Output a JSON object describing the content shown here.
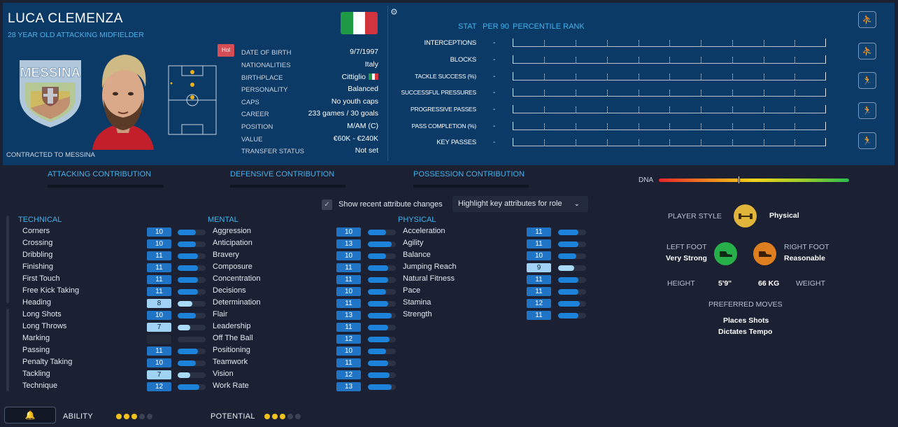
{
  "player": {
    "name": "LUCA CLEMENZA",
    "subtitle": "28 YEAR OLD  ATTACKING MIDFIELDER",
    "contract": "CONTRACTED TO MESSINA",
    "club_badge_text": "MESSINA",
    "hol_tag": "Hol",
    "flag_colors": [
      "#1f9a45",
      "#ffffff",
      "#d2343d"
    ]
  },
  "info": [
    {
      "label": "DATE OF BIRTH",
      "value": "9/7/1997"
    },
    {
      "label": "NATIONALITIES",
      "value": "Italy"
    },
    {
      "label": "BIRTHPLACE",
      "value": "Cittiglio"
    },
    {
      "label": "PERSONALITY",
      "value": "Balanced"
    },
    {
      "label": "CAPS",
      "value": "No youth caps"
    },
    {
      "label": "CAREER",
      "value": "233 games /  30  goals"
    },
    {
      "label": "POSITION",
      "value": "M/AM (C)"
    },
    {
      "label": "VALUE",
      "value": "€60K - €240K"
    },
    {
      "label": "TRANSFER STATUS",
      "value": "Not set"
    }
  ],
  "stats": {
    "headers": {
      "stat": "STAT",
      "per90": "PER 90",
      "rank": "PERCENTILE RANK"
    },
    "rows": [
      {
        "label": "INTERCEPTIONS",
        "per90": "-"
      },
      {
        "label": "BLOCKS",
        "per90": "-"
      },
      {
        "label": "TACKLE SUCCESS (%)",
        "per90": "-"
      },
      {
        "label": "SUCCESSFUL PRESSURES",
        "per90": "-"
      },
      {
        "label": "PROGRESSIVE PASSES",
        "per90": "-"
      },
      {
        "label": "PASS COMPLETION (%)",
        "per90": "-"
      },
      {
        "label": "KEY PASSES",
        "per90": "-"
      }
    ]
  },
  "contribution": {
    "attacking": "ATTACKING CONTRIBUTION",
    "defensive": "DEFENSIVE CONTRIBUTION",
    "possession": "POSSESSION CONTRIBUTION"
  },
  "dna": {
    "label": "DNA",
    "level": 0.42
  },
  "toolbar": {
    "show_changes": "Show recent attribute changes",
    "highlight": "Highlight key attributes for role"
  },
  "attributes": {
    "technical": {
      "title": "TECHNICAL",
      "items": [
        {
          "name": "Corners",
          "value": "10"
        },
        {
          "name": "Crossing",
          "value": "10"
        },
        {
          "name": "Dribbling",
          "value": "11"
        },
        {
          "name": "Finishing",
          "value": "11"
        },
        {
          "name": "First Touch",
          "value": "11"
        },
        {
          "name": "Free Kick Taking",
          "value": "11"
        },
        {
          "name": "Heading",
          "value": "8"
        },
        {
          "name": "Long Shots",
          "value": "10"
        },
        {
          "name": "Long Throws",
          "value": "7"
        },
        {
          "name": "Marking",
          "value": ""
        },
        {
          "name": "Passing",
          "value": "11"
        },
        {
          "name": "Penalty Taking",
          "value": "10"
        },
        {
          "name": "Tackling",
          "value": "7"
        },
        {
          "name": "Technique",
          "value": "12"
        }
      ]
    },
    "mental": {
      "title": "MENTAL",
      "items": [
        {
          "name": "Aggression",
          "value": "10"
        },
        {
          "name": "Anticipation",
          "value": "13"
        },
        {
          "name": "Bravery",
          "value": "10"
        },
        {
          "name": "Composure",
          "value": "11"
        },
        {
          "name": "Concentration",
          "value": "11"
        },
        {
          "name": "Decisions",
          "value": "10"
        },
        {
          "name": "Determination",
          "value": "11"
        },
        {
          "name": "Flair",
          "value": "13"
        },
        {
          "name": "Leadership",
          "value": "11"
        },
        {
          "name": "Off The Ball",
          "value": "12"
        },
        {
          "name": "Positioning",
          "value": "10"
        },
        {
          "name": "Teamwork",
          "value": "11"
        },
        {
          "name": "Vision",
          "value": "12"
        },
        {
          "name": "Work Rate",
          "value": "13"
        }
      ]
    },
    "physical": {
      "title": "PHYSICAL",
      "items": [
        {
          "name": "Acceleration",
          "value": "11"
        },
        {
          "name": "Agility",
          "value": "11"
        },
        {
          "name": "Balance",
          "value": "10"
        },
        {
          "name": "Jumping Reach",
          "value": "9"
        },
        {
          "name": "Natural Fitness",
          "value": "11"
        },
        {
          "name": "Pace",
          "value": "11"
        },
        {
          "name": "Stamina",
          "value": "12"
        },
        {
          "name": "Strength",
          "value": "11"
        }
      ]
    }
  },
  "profile": {
    "player_style_label": "PLAYER STYLE",
    "player_style": "Physical",
    "left_foot_label": "LEFT FOOT",
    "left_foot": "Very Strong",
    "right_foot_label": "RIGHT FOOT",
    "right_foot": "Reasonable",
    "height_label": "HEIGHT",
    "height": "5'9\"",
    "weight": "66 KG",
    "weight_label": "WEIGHT",
    "preferred_moves_label": "PREFERRED MOVES",
    "preferred_moves": [
      "Places Shots",
      "Dictates Tempo"
    ],
    "colors": {
      "style": "#e1b43a",
      "left_foot": "#27b04a",
      "right_foot": "#dd7f1e"
    }
  },
  "footer": {
    "ability_label": "ABILITY",
    "ability_stars": 3,
    "potential_label": "POTENTIAL",
    "potential_stars": 3,
    "star_total": 5
  }
}
